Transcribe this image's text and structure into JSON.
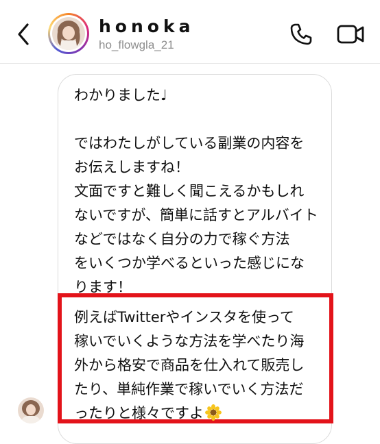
{
  "header": {
    "display_name": "honoka",
    "username": "ho_flowgla_21",
    "back_icon": "chevron-left-icon",
    "call_icon": "phone-icon",
    "video_icon": "video-camera-icon"
  },
  "messages": [
    {
      "text": "わかりました♩"
    },
    {
      "text": "ではわたしがしている副業の内容を\nお伝えしますね！\n文面ですと難しく聞こえるかもしれ\nないですが、簡単に話すとアルバイト\nなどではなく自分の力で稼ぐ方法\nをいくつか学べるといった感じにな\nります！"
    },
    {
      "text": "例えばTwitterやインスタを使って\n稼いでいくような方法を学べたり海\n外から格安で商品を仕入れて販売し\nたり、単純作業で稼いでいく方法だ\nったりと様々ですよ",
      "emoji": "sunflower-emoji",
      "highlighted": true
    }
  ],
  "colors": {
    "highlight_border": "#e3131a",
    "bubble_border": "#dbdbdb",
    "username": "#8e8e8e"
  }
}
